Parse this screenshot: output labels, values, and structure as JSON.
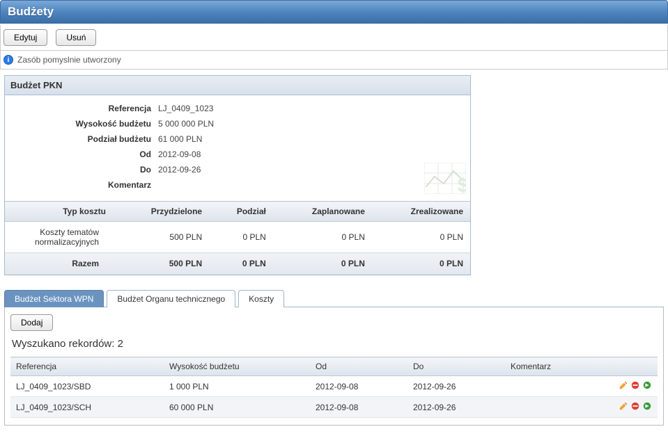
{
  "header": {
    "title": "Budżety"
  },
  "toolbar": {
    "edit_label": "Edytuj",
    "delete_label": "Usuń"
  },
  "status": {
    "message": "Zasób pomyslnie utworzony"
  },
  "panel": {
    "title": "Budżet PKN",
    "fields": {
      "referencja_label": "Referencja",
      "referencja_value": "LJ_0409_1023",
      "wysokosc_label": "Wysokość budżetu",
      "wysokosc_value": "5 000 000 PLN",
      "podzial_label": "Podział budżetu",
      "podzial_value": "61 000 PLN",
      "od_label": "Od",
      "od_value": "2012-09-08",
      "do_label": "Do",
      "do_value": "2012-09-26",
      "komentarz_label": "Komentarz",
      "komentarz_value": ""
    },
    "cost_table": {
      "headers": {
        "typ": "Typ kosztu",
        "przydzielone": "Przydzielone",
        "podzial": "Podział",
        "zaplanowane": "Zaplanowane",
        "zrealizowane": "Zrealizowane"
      },
      "rows": [
        {
          "typ": "Koszty tematów normalizacyjnych",
          "przydzielone": "500 PLN",
          "podzial": "0 PLN",
          "zaplanowane": "0 PLN",
          "zrealizowane": "0 PLN"
        }
      ],
      "sum": {
        "label": "Razem",
        "przydzielone": "500 PLN",
        "podzial": "0 PLN",
        "zaplanowane": "0 PLN",
        "zrealizowane": "0 PLN"
      }
    }
  },
  "tabs": {
    "items": [
      {
        "label": "Budżet Sektora WPN"
      },
      {
        "label": "Budżet Organu technicznego"
      },
      {
        "label": "Koszty"
      }
    ],
    "add_label": "Dodaj",
    "results_label": "Wyszukano rekordów: 2",
    "table": {
      "headers": {
        "referencja": "Referencja",
        "wysokosc": "Wysokość budżetu",
        "od": "Od",
        "do_": "Do",
        "komentarz": "Komentarz"
      },
      "rows": [
        {
          "referencja": "LJ_0409_1023/SBD",
          "wysokosc": "1 000 PLN",
          "od": "2012-09-08",
          "do_": "2012-09-26",
          "komentarz": ""
        },
        {
          "referencja": "LJ_0409_1023/SCH",
          "wysokosc": "60 000 PLN",
          "od": "2012-09-08",
          "do_": "2012-09-26",
          "komentarz": ""
        }
      ]
    }
  }
}
